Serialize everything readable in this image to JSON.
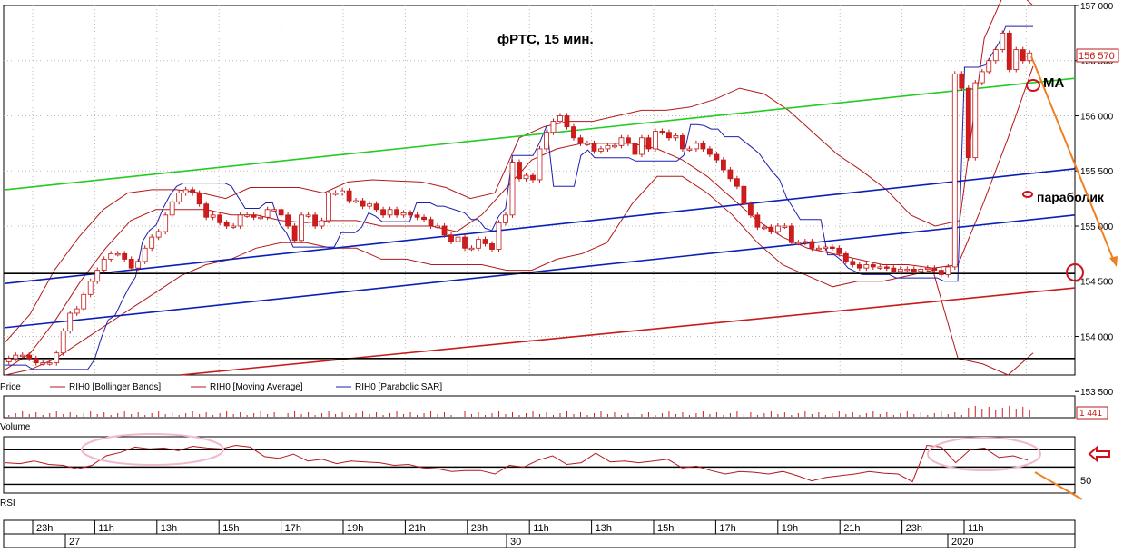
{
  "chart_data": [
    {
      "panel": "price",
      "type": "candlestick",
      "title": "фРТС,  15 мин.",
      "ylim": [
        153650,
        157000
      ],
      "y_ticks": [
        "157 000",
        "156 500",
        "156 000",
        "155 500",
        "155 000",
        "154 500",
        "154 000",
        "153 500"
      ],
      "last_price_label": "156 570",
      "grid": true,
      "legend": [
        {
          "label": "Price",
          "color": "#000000"
        },
        {
          "label": "RIH0 [Bollinger Bands]",
          "color": "#b3181a"
        },
        {
          "label": "RIH0 [Moving Average]",
          "color": "#b3181a"
        },
        {
          "label": "RIH0 [Parabolic SAR]",
          "color": "#1f1fb0"
        }
      ],
      "annotations": [
        {
          "text": "MA",
          "color": "#000000"
        },
        {
          "text": "параболик",
          "color": "#000000"
        }
      ],
      "colors": {
        "candle_up": "#ffffff",
        "candle_down": "#d01c1c",
        "wick": "#c01818",
        "bollinger": "#b3181a",
        "moving_average": "#b3181a",
        "parabolic_sar": "#1f1fb0",
        "trend_green": "#22cc22",
        "trend_blue": "#0a1fb8",
        "trend_red": "#c81a1a",
        "level": "#000000",
        "arrow": "#f07f22",
        "marker": "#d0101a"
      },
      "levels": [
        154570,
        153800
      ],
      "trend_lines": [
        {
          "color": "green",
          "from": {
            "x": 0,
            "y": 155330
          },
          "to": {
            "x": 171,
            "y": 156340
          }
        },
        {
          "color": "blue",
          "from": {
            "x": 0,
            "y": 154480
          },
          "to": {
            "x": 171,
            "y": 155520
          }
        },
        {
          "color": "blue",
          "from": {
            "x": 0,
            "y": 154080
          },
          "to": {
            "x": 171,
            "y": 155100
          }
        },
        {
          "color": "red",
          "from": {
            "x": 28,
            "y": 153650
          },
          "to": {
            "x": 171,
            "y": 154440
          }
        }
      ],
      "candles_close": [
        153800,
        153830,
        153830,
        153800,
        153760,
        153760,
        153760,
        153850,
        154050,
        154210,
        154250,
        154380,
        154500,
        154600,
        154700,
        154750,
        154750,
        154700,
        154620,
        154680,
        154800,
        154900,
        154950,
        155100,
        155220,
        155300,
        155330,
        155300,
        155200,
        155080,
        155100,
        155030,
        155000,
        155000,
        155100,
        155100,
        155080,
        155080,
        155150,
        155150,
        155100,
        155000,
        154870,
        155100,
        155100,
        155000,
        155050,
        155300,
        155300,
        155320,
        155230,
        155230,
        155180,
        155200,
        155150,
        155100,
        155150,
        155100,
        155120,
        155100,
        155080,
        155060,
        155000,
        155000,
        154920,
        154860,
        154900,
        154800,
        154800,
        154880,
        154840,
        154790,
        155030,
        155100,
        155580,
        155430,
        155460,
        155420,
        155700,
        155850,
        155950,
        156000,
        155900,
        155800,
        155750,
        155750,
        155680,
        155700,
        155730,
        155730,
        155800,
        155750,
        155650,
        155800,
        155700,
        155860,
        155850,
        155800,
        155820,
        155700,
        155700,
        155750,
        155700,
        155650,
        155600,
        155510,
        155430,
        155360,
        155200,
        155100,
        154990,
        154990,
        154950,
        155000,
        155000,
        154850,
        154850,
        154860,
        154800,
        154800,
        154810,
        154800,
        154750,
        154680,
        154650,
        154620,
        154650,
        154630,
        154630,
        154620,
        154590,
        154610,
        154610,
        154590,
        154610,
        154620,
        154600,
        154560,
        154630,
        156380,
        156250,
        155620,
        156300,
        156400,
        156500,
        156600,
        156750,
        156420,
        156600,
        156500,
        156570
      ],
      "bollinger_upper": [
        153950,
        154200,
        154600,
        154900,
        155150,
        155300,
        155330,
        155330,
        155300,
        155250,
        155350,
        155350,
        155350,
        155300,
        155400,
        155420,
        155410,
        155400,
        155350,
        155250,
        155300,
        155800,
        155900,
        155950,
        155950,
        156000,
        156050,
        156050,
        156080,
        156150,
        156250,
        156200,
        156050,
        155850,
        155650,
        155500,
        155330,
        155100,
        155000,
        155050,
        156700,
        157200,
        157000
      ],
      "bollinger_lower": [
        153650,
        153700,
        153800,
        153950,
        154100,
        154250,
        154400,
        154550,
        154650,
        154700,
        154800,
        154850,
        154850,
        154800,
        154800,
        154700,
        154700,
        154650,
        154650,
        154650,
        154600,
        154600,
        154700,
        154750,
        154850,
        155200,
        155450,
        155450,
        155300,
        155100,
        154850,
        154650,
        154550,
        154450,
        154500,
        154500,
        154550,
        154600,
        153800,
        153750,
        153650,
        153850
      ],
      "moving_average": [
        153700,
        153850,
        154150,
        154500,
        154800,
        155050,
        155150,
        155150,
        155150,
        155100,
        155100,
        155050,
        155030,
        155050,
        155050,
        155000,
        155000,
        155000,
        154950,
        155100,
        155350,
        155600,
        155700,
        155750,
        155750,
        155750,
        155700,
        155600,
        155450,
        155250,
        155050,
        154900,
        154800,
        154750,
        154700,
        154650,
        154650,
        154620,
        154650,
        155200,
        155800,
        156450
      ]
    },
    {
      "panel": "volume",
      "type": "bar",
      "label": "Volume",
      "last_value_label": "1 441"
    },
    {
      "panel": "rsi",
      "type": "line",
      "label": "RSI",
      "y_tick_label": "50",
      "levels": [
        70,
        50,
        30
      ],
      "series": [
        {
          "values": [
            55,
            54,
            57,
            53,
            52,
            48,
            52,
            63,
            67,
            73,
            71,
            72,
            69,
            74,
            72,
            71,
            75,
            73,
            62,
            60,
            65,
            57,
            59,
            54,
            57,
            56,
            55,
            52,
            53,
            49,
            48,
            45,
            46,
            46,
            42,
            52,
            50,
            58,
            63,
            53,
            55,
            66,
            56,
            57,
            55,
            57,
            59,
            49,
            51,
            46,
            42,
            45,
            44,
            42,
            45,
            40,
            34,
            38,
            40,
            42,
            45,
            43,
            42,
            33,
            75,
            73,
            55,
            70,
            72,
            61,
            63,
            58
          ]
        }
      ]
    },
    {
      "panel": "time-axis",
      "type": "axis",
      "hours": [
        "23h",
        "11h",
        "13h",
        "15h",
        "17h",
        "19h",
        "21h",
        "23h",
        "11h",
        "13h",
        "15h",
        "17h",
        "19h",
        "21h",
        "23h",
        "11h"
      ],
      "dates": [
        "27",
        "30",
        "2020"
      ]
    }
  ]
}
